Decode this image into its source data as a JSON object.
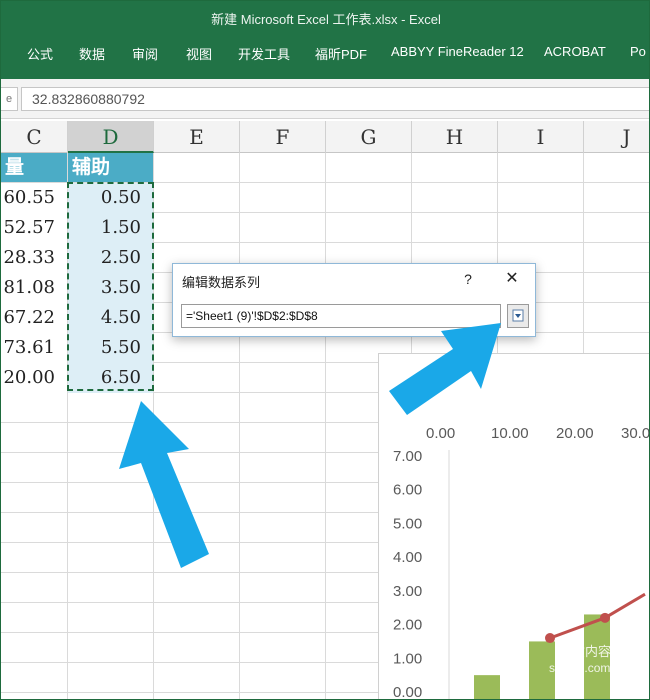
{
  "window": {
    "title": "新建 Microsoft Excel 工作表.xlsx  -  Excel"
  },
  "ribbon": {
    "tabs": [
      "公式",
      "数据",
      "审阅",
      "视图",
      "开发工具",
      "福昕PDF",
      "ABBYY FineReader 12",
      "ACROBAT",
      "Po"
    ]
  },
  "formula_bar": {
    "value": "32.832860880792",
    "name_box_tail": "e"
  },
  "column_headers": [
    "C",
    "D",
    "E",
    "F",
    "G",
    "H",
    "I",
    "J"
  ],
  "table": {
    "header_c": "量",
    "header_d": "辅助",
    "rows": [
      {
        "c": "60.55",
        "d": "0.50"
      },
      {
        "c": "52.57",
        "d": "1.50"
      },
      {
        "c": "28.33",
        "d": "2.50"
      },
      {
        "c": "81.08",
        "d": "3.50"
      },
      {
        "c": "67.22",
        "d": "4.50"
      },
      {
        "c": "73.61",
        "d": "5.50"
      },
      {
        "c": "20.00",
        "d": "6.50"
      }
    ]
  },
  "dialog": {
    "title": "编辑数据系列",
    "help": "?",
    "close": "✕",
    "range_value": "='Sheet1 (9)'!$D$2:$D$8",
    "collapse_icon": "collapse-dialog-icon"
  },
  "chart_data": {
    "type": "bar",
    "top_axis_ticks": [
      "0.00",
      "10.00",
      "20.00",
      "30.0"
    ],
    "y_ticks": [
      "7.00",
      "6.00",
      "5.00",
      "4.00",
      "3.00",
      "2.00",
      "1.00",
      "0.00"
    ],
    "ylim": [
      0,
      7
    ],
    "bars": [
      {
        "category_index": 0,
        "value": 0.5
      },
      {
        "category_index": 1,
        "value": 1.5
      },
      {
        "category_index": 2,
        "value": 2.3
      }
    ],
    "line_points": [
      {
        "x": 1,
        "y": 1.6
      },
      {
        "x": 2,
        "y": 2.2
      }
    ],
    "colors": {
      "bar": "#9bbb59",
      "line": "#c0504d"
    }
  },
  "watermark": {
    "line1": "优质内容",
    "line2": "shinan.com"
  },
  "colors": {
    "excel_green": "#217346",
    "arrow": "#1aa8e8",
    "table_header": "#4bacc6"
  }
}
